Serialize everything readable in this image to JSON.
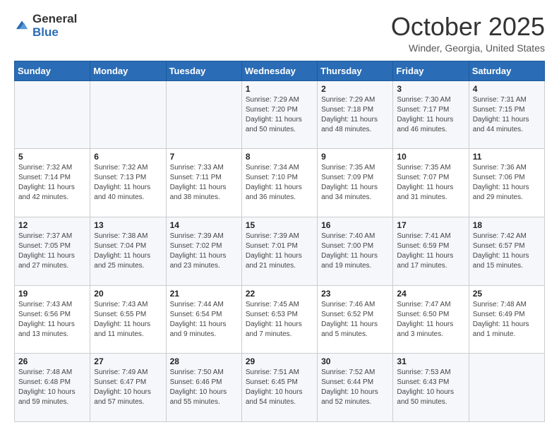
{
  "logo": {
    "general": "General",
    "blue": "Blue"
  },
  "header": {
    "month": "October 2025",
    "location": "Winder, Georgia, United States"
  },
  "days_of_week": [
    "Sunday",
    "Monday",
    "Tuesday",
    "Wednesday",
    "Thursday",
    "Friday",
    "Saturday"
  ],
  "weeks": [
    [
      {
        "day": "",
        "info": ""
      },
      {
        "day": "",
        "info": ""
      },
      {
        "day": "",
        "info": ""
      },
      {
        "day": "1",
        "info": "Sunrise: 7:29 AM\nSunset: 7:20 PM\nDaylight: 11 hours\nand 50 minutes."
      },
      {
        "day": "2",
        "info": "Sunrise: 7:29 AM\nSunset: 7:18 PM\nDaylight: 11 hours\nand 48 minutes."
      },
      {
        "day": "3",
        "info": "Sunrise: 7:30 AM\nSunset: 7:17 PM\nDaylight: 11 hours\nand 46 minutes."
      },
      {
        "day": "4",
        "info": "Sunrise: 7:31 AM\nSunset: 7:15 PM\nDaylight: 11 hours\nand 44 minutes."
      }
    ],
    [
      {
        "day": "5",
        "info": "Sunrise: 7:32 AM\nSunset: 7:14 PM\nDaylight: 11 hours\nand 42 minutes."
      },
      {
        "day": "6",
        "info": "Sunrise: 7:32 AM\nSunset: 7:13 PM\nDaylight: 11 hours\nand 40 minutes."
      },
      {
        "day": "7",
        "info": "Sunrise: 7:33 AM\nSunset: 7:11 PM\nDaylight: 11 hours\nand 38 minutes."
      },
      {
        "day": "8",
        "info": "Sunrise: 7:34 AM\nSunset: 7:10 PM\nDaylight: 11 hours\nand 36 minutes."
      },
      {
        "day": "9",
        "info": "Sunrise: 7:35 AM\nSunset: 7:09 PM\nDaylight: 11 hours\nand 34 minutes."
      },
      {
        "day": "10",
        "info": "Sunrise: 7:35 AM\nSunset: 7:07 PM\nDaylight: 11 hours\nand 31 minutes."
      },
      {
        "day": "11",
        "info": "Sunrise: 7:36 AM\nSunset: 7:06 PM\nDaylight: 11 hours\nand 29 minutes."
      }
    ],
    [
      {
        "day": "12",
        "info": "Sunrise: 7:37 AM\nSunset: 7:05 PM\nDaylight: 11 hours\nand 27 minutes."
      },
      {
        "day": "13",
        "info": "Sunrise: 7:38 AM\nSunset: 7:04 PM\nDaylight: 11 hours\nand 25 minutes."
      },
      {
        "day": "14",
        "info": "Sunrise: 7:39 AM\nSunset: 7:02 PM\nDaylight: 11 hours\nand 23 minutes."
      },
      {
        "day": "15",
        "info": "Sunrise: 7:39 AM\nSunset: 7:01 PM\nDaylight: 11 hours\nand 21 minutes."
      },
      {
        "day": "16",
        "info": "Sunrise: 7:40 AM\nSunset: 7:00 PM\nDaylight: 11 hours\nand 19 minutes."
      },
      {
        "day": "17",
        "info": "Sunrise: 7:41 AM\nSunset: 6:59 PM\nDaylight: 11 hours\nand 17 minutes."
      },
      {
        "day": "18",
        "info": "Sunrise: 7:42 AM\nSunset: 6:57 PM\nDaylight: 11 hours\nand 15 minutes."
      }
    ],
    [
      {
        "day": "19",
        "info": "Sunrise: 7:43 AM\nSunset: 6:56 PM\nDaylight: 11 hours\nand 13 minutes."
      },
      {
        "day": "20",
        "info": "Sunrise: 7:43 AM\nSunset: 6:55 PM\nDaylight: 11 hours\nand 11 minutes."
      },
      {
        "day": "21",
        "info": "Sunrise: 7:44 AM\nSunset: 6:54 PM\nDaylight: 11 hours\nand 9 minutes."
      },
      {
        "day": "22",
        "info": "Sunrise: 7:45 AM\nSunset: 6:53 PM\nDaylight: 11 hours\nand 7 minutes."
      },
      {
        "day": "23",
        "info": "Sunrise: 7:46 AM\nSunset: 6:52 PM\nDaylight: 11 hours\nand 5 minutes."
      },
      {
        "day": "24",
        "info": "Sunrise: 7:47 AM\nSunset: 6:50 PM\nDaylight: 11 hours\nand 3 minutes."
      },
      {
        "day": "25",
        "info": "Sunrise: 7:48 AM\nSunset: 6:49 PM\nDaylight: 11 hours\nand 1 minute."
      }
    ],
    [
      {
        "day": "26",
        "info": "Sunrise: 7:48 AM\nSunset: 6:48 PM\nDaylight: 10 hours\nand 59 minutes."
      },
      {
        "day": "27",
        "info": "Sunrise: 7:49 AM\nSunset: 6:47 PM\nDaylight: 10 hours\nand 57 minutes."
      },
      {
        "day": "28",
        "info": "Sunrise: 7:50 AM\nSunset: 6:46 PM\nDaylight: 10 hours\nand 55 minutes."
      },
      {
        "day": "29",
        "info": "Sunrise: 7:51 AM\nSunset: 6:45 PM\nDaylight: 10 hours\nand 54 minutes."
      },
      {
        "day": "30",
        "info": "Sunrise: 7:52 AM\nSunset: 6:44 PM\nDaylight: 10 hours\nand 52 minutes."
      },
      {
        "day": "31",
        "info": "Sunrise: 7:53 AM\nSunset: 6:43 PM\nDaylight: 10 hours\nand 50 minutes."
      },
      {
        "day": "",
        "info": ""
      }
    ]
  ]
}
